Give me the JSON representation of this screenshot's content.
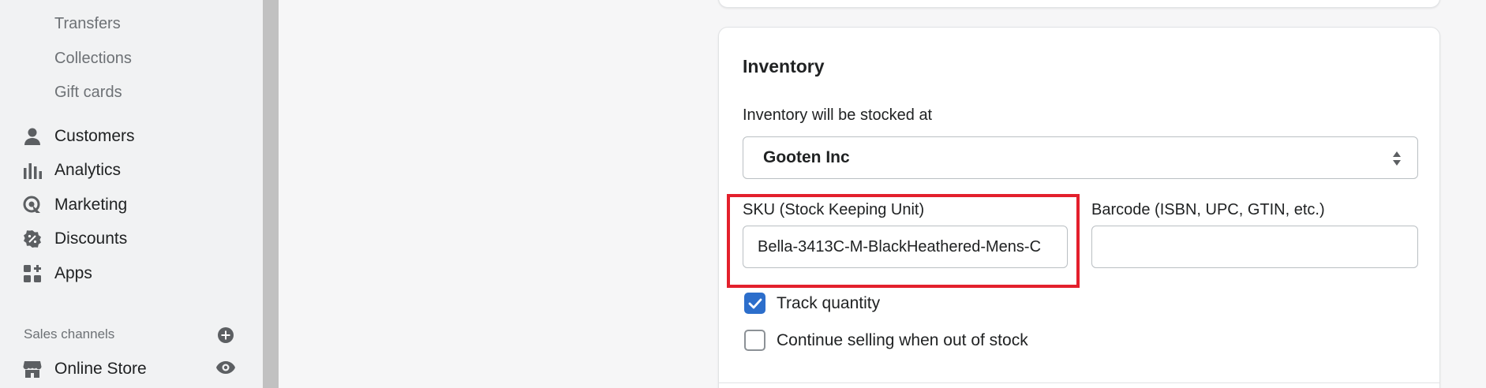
{
  "sidebar": {
    "sub_items": [
      "Transfers",
      "Collections",
      "Gift cards"
    ],
    "items": [
      {
        "label": "Customers",
        "icon": "person-icon"
      },
      {
        "label": "Analytics",
        "icon": "bar-chart-icon"
      },
      {
        "label": "Marketing",
        "icon": "marketing-icon"
      },
      {
        "label": "Discounts",
        "icon": "discount-icon"
      },
      {
        "label": "Apps",
        "icon": "apps-icon"
      }
    ],
    "sales_channels_label": "Sales channels",
    "channels": [
      {
        "label": "Online Store",
        "icon": "store-icon"
      }
    ]
  },
  "inventory": {
    "title": "Inventory",
    "location_label": "Inventory will be stocked at",
    "location_value": "Gooten Inc",
    "sku_label": "SKU (Stock Keeping Unit)",
    "sku_value": "Bella-3413C-M-BlackHeathered-Mens-C",
    "barcode_label": "Barcode (ISBN, UPC, GTIN, etc.)",
    "barcode_value": "",
    "track_quantity_label": "Track quantity",
    "track_quantity_checked": true,
    "continue_selling_label": "Continue selling when out of stock",
    "continue_selling_checked": false
  },
  "colors": {
    "accent": "#2c6ecb",
    "highlight": "#e3202c"
  }
}
